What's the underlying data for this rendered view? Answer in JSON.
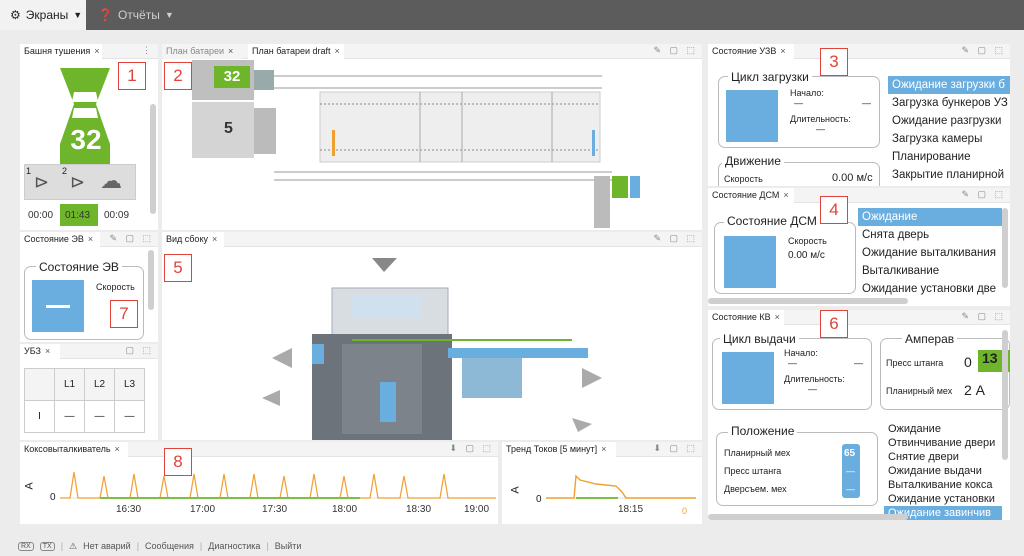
{
  "topbar": {
    "screens": "Экраны",
    "reports": "Отчёты"
  },
  "markers": [
    "1",
    "2",
    "3",
    "4",
    "5",
    "6",
    "7",
    "8"
  ],
  "tower": {
    "tab": "Башня тушения",
    "number": "32",
    "t1": "00:00",
    "t2": "01:43",
    "t3": "00:09",
    "s1": "1",
    "s2": "2"
  },
  "plan": {
    "tab1": "План батареи",
    "tab2": "План батареи draft",
    "num1": "32",
    "num2": "5"
  },
  "uzv": {
    "tab": "Состояние УЗВ",
    "cycle_title": "Цикл загрузки",
    "start_label": "Начало:",
    "start_val": "—",
    "start_val2": "—",
    "dur_label": "Длительность:",
    "dur_val": "—",
    "move_title": "Движение",
    "speed_label": "Скорость",
    "speed_val": "0.00 м/с",
    "states": [
      "Ожидание загрузки б",
      "Загрузка бункеров УЗ",
      "Ожидание разгрузки",
      "Загрузка камеры",
      "Планирование",
      "Закрытие планирной"
    ]
  },
  "dsm": {
    "tab": "Состояние ДСМ",
    "title": "Состояние ДСМ",
    "speed_label": "Скорость",
    "speed_val": "0.00 м/с",
    "states": [
      "Ожидание",
      "Снята дверь",
      "Ожидание выталкивания",
      "Выталкивание",
      "Ожидание установки две"
    ]
  },
  "ev": {
    "tab": "Состояние ЭВ",
    "title": "Состояние ЭВ",
    "speed_label": "Скорость"
  },
  "ubz": {
    "tab": "УБЗ",
    "cols": [
      "L1",
      "L2",
      "L3"
    ],
    "rows": [
      [
        "I",
        "—",
        "—",
        "—"
      ]
    ]
  },
  "side": {
    "tab": "Вид сбоку"
  },
  "kv": {
    "tab": "Состояние КВ",
    "cycle_title": "Цикл выдачи",
    "start_label": "Начало:",
    "start_val": "—",
    "start_val2": "—",
    "dur_label": "Длительность:",
    "dur_val": "—",
    "amp_title": "Амперав",
    "press_label": "Пресс штанга",
    "press_val": "0",
    "press_badge": "13",
    "plan_label": "Планирный мех",
    "plan_val": "2 А",
    "pos_title": "Положение",
    "pos_plan": "Планирный мех",
    "pos_plan_val": "65",
    "pos_press": "Пресс штанга",
    "pos_door": "Дверсъем. мех",
    "dash": "—",
    "states": [
      "Ожидание",
      "Отвинчивание двери",
      "Снятие двери",
      "Ожидание выдачи",
      "Выталкивание кокса",
      "Ожидание установки",
      "Ожидание завинчив"
    ]
  },
  "koks": {
    "tab": "Коксовыталкиватель",
    "y_unit": "A",
    "y_zero": "0",
    "times": [
      "16:30",
      "17:00",
      "17:30",
      "18:00",
      "18:30",
      "19:00"
    ]
  },
  "trend": {
    "tab": "Тренд Токов [5 минут]",
    "y_unit": "A",
    "y_zero": "0",
    "time": "18:15",
    "value": "0"
  },
  "status": {
    "rx": "RX",
    "tx": "TX",
    "alarm": "Нет аварий",
    "messages": "Сообщения",
    "diag": "Диагностика",
    "exit": "Выйти"
  },
  "colors": {
    "green": "#6fb52c",
    "blue": "#6aaee0",
    "red": "#e0433a",
    "orange": "#f0a030",
    "chart_green": "#7ac143"
  }
}
